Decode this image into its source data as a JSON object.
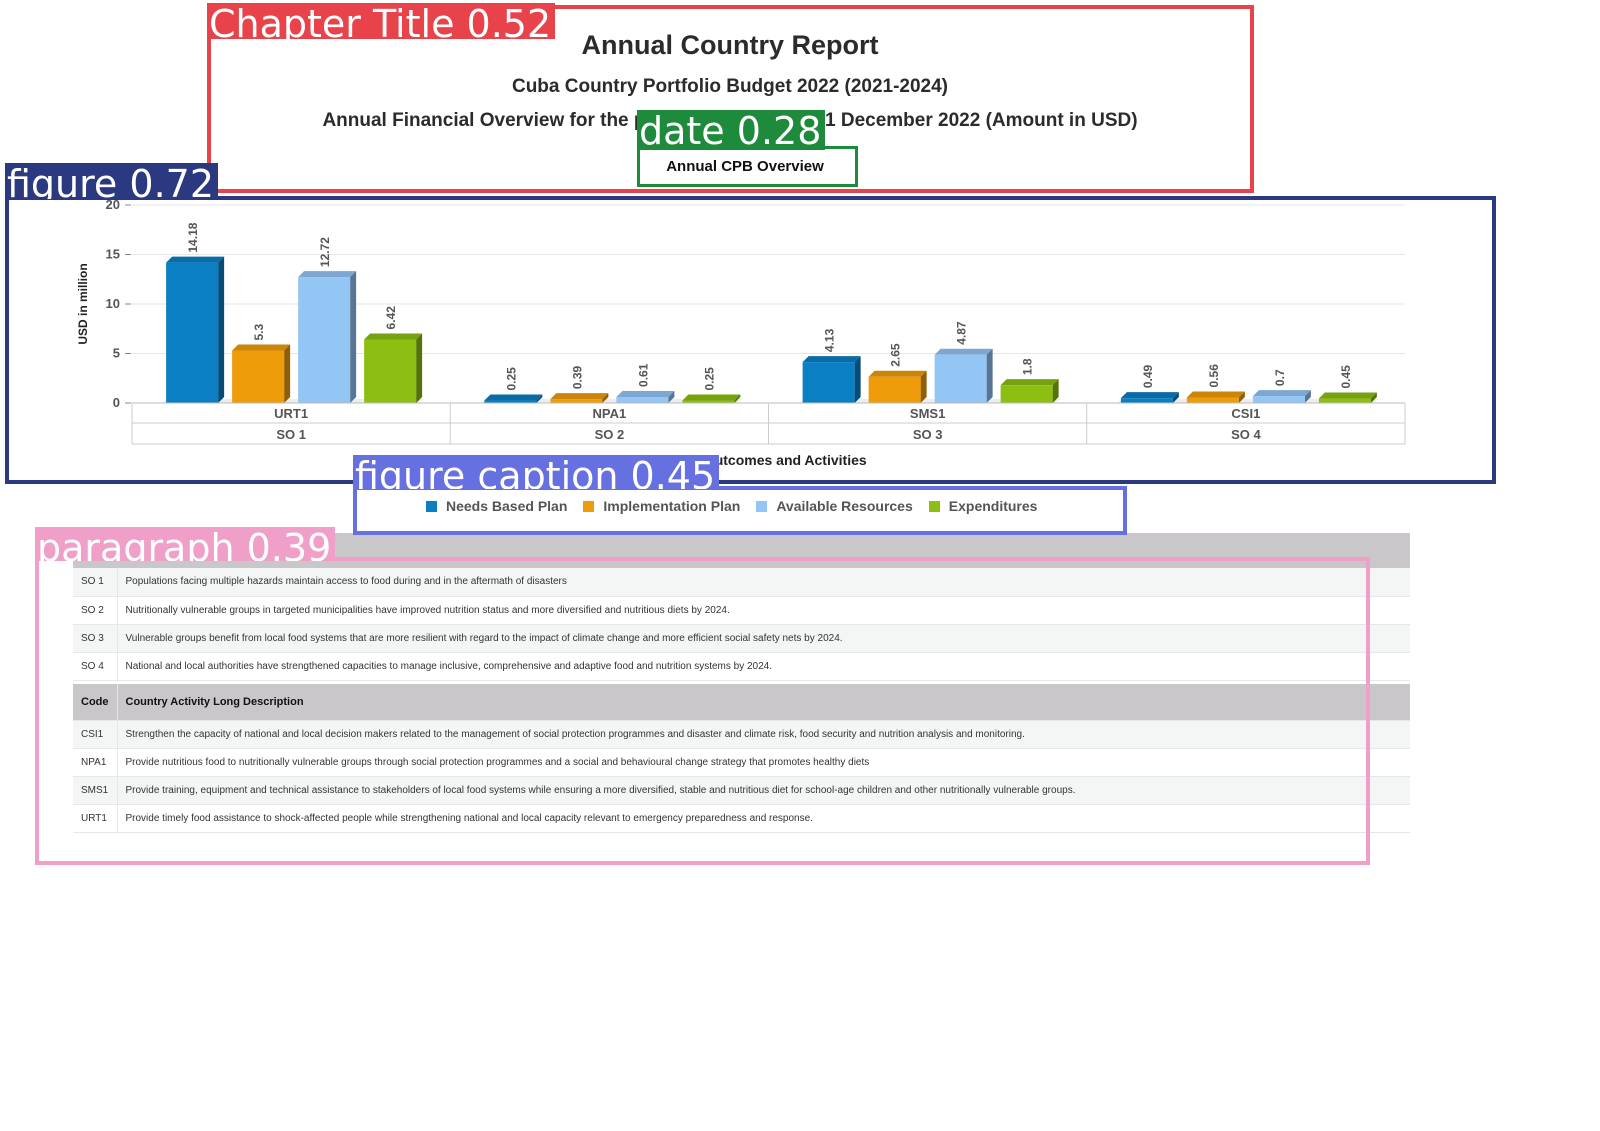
{
  "header": {
    "title": "Annual Country Report",
    "subtitle": "Cuba Country Portfolio Budget 2022 (2021-2024)",
    "overview_line": "Annual Financial Overview for the period 1 January to 31 December 2022 (Amount in USD)",
    "section_heading": "Annual CPB Overview"
  },
  "detections": {
    "chapter_title": "Chapter Title 0.52",
    "date": "date 0.28",
    "figure": "figure 0.72",
    "figure_caption": "figure caption 0.45",
    "paragraph": "paragraph 0.39",
    "colors": {
      "chapter_title": "#e8434b",
      "date": "#1e8a3c",
      "figure": "#2b3a80",
      "figure_caption": "#6670e0",
      "paragraph": "#f0a0c8"
    }
  },
  "chart_data": {
    "type": "bar",
    "ylabel": "USD in million",
    "xlabel": "Strategic Outcomes and Activities",
    "ylim": [
      0,
      20
    ],
    "yticks": [
      "0",
      "5",
      "10",
      "15",
      "20"
    ],
    "grid": true,
    "legend_position": "bottom",
    "categories": [
      "URT1",
      "NPA1",
      "SMS1",
      "CSI1"
    ],
    "groups": [
      "SO 1",
      "SO 2",
      "SO 3",
      "SO 4"
    ],
    "series": [
      {
        "name": "Needs Based Plan",
        "color": "#0a7fc4",
        "values": [
          14.18,
          0.25,
          4.13,
          0.49
        ]
      },
      {
        "name": "Implementation Plan",
        "color": "#ef9c0b",
        "values": [
          5.3,
          0.39,
          2.65,
          0.56
        ]
      },
      {
        "name": "Available Resources",
        "color": "#93c5f5",
        "values": [
          12.72,
          0.61,
          4.87,
          0.7
        ]
      },
      {
        "name": "Expenditures",
        "color": "#8cbf12",
        "values": [
          6.42,
          0.25,
          1.8,
          0.45
        ]
      }
    ]
  },
  "so_table": {
    "rows": [
      {
        "code": "SO 1",
        "text": "Populations facing multiple hazards maintain access to food during and in the aftermath of disasters"
      },
      {
        "code": "SO 2",
        "text": "Nutritionally vulnerable groups in targeted municipalities have improved nutrition status and more diversified and nutritious diets by 2024."
      },
      {
        "code": "SO 3",
        "text": "Vulnerable groups benefit from local food systems that are more resilient with regard to the impact of climate change and more efficient social safety nets by 2024."
      },
      {
        "code": "SO 4",
        "text": "National and local authorities have strengthened capacities to manage inclusive, comprehensive and adaptive food and nutrition systems by 2024."
      }
    ]
  },
  "activity_table": {
    "header_code": "Code",
    "header_description": "Country Activity Long Description",
    "rows": [
      {
        "code": "CSI1",
        "text": "Strengthen the capacity of national and local decision makers related to the management of social protection programmes and disaster and climate risk, food security and nutrition analysis and monitoring."
      },
      {
        "code": "NPA1",
        "text": "Provide nutritious food to nutritionally vulnerable groups through social protection programmes and a social and behavioural change strategy that promotes healthy diets"
      },
      {
        "code": "SMS1",
        "text": "Provide training, equipment and technical assistance to stakeholders of local food systems while ensuring a more diversified, stable and nutritious diet for school-age children and other nutritionally vulnerable groups."
      },
      {
        "code": "URT1",
        "text": "Provide timely food assistance to shock-affected people while strengthening national and local capacity relevant to emergency preparedness and response."
      }
    ]
  }
}
